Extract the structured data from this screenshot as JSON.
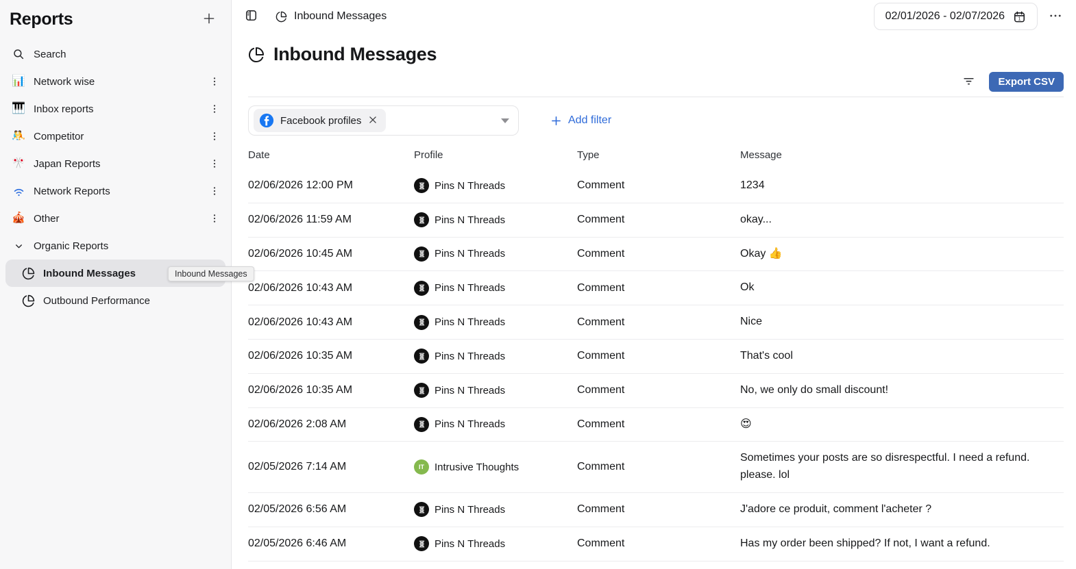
{
  "sidebar": {
    "title": "Reports",
    "tooltip": "Inbound Messages",
    "items": [
      {
        "label": "Search",
        "icon": "search"
      },
      {
        "label": "Network wise",
        "icon": "bar-chart-emoji",
        "glyph": "📊"
      },
      {
        "label": "Inbox reports",
        "icon": "piano-emoji",
        "glyph": "🎹"
      },
      {
        "label": "Competitor",
        "icon": "wrestlers-emoji",
        "glyph": "🤼"
      },
      {
        "label": "Japan Reports",
        "icon": "crossed-flags-emoji",
        "glyph": "🎌"
      },
      {
        "label": "Network Reports",
        "icon": "wifi"
      },
      {
        "label": "Other",
        "icon": "circus-tent-emoji",
        "glyph": "🎪"
      },
      {
        "label": "Organic Reports",
        "icon": "chevron-down"
      },
      {
        "label": "Inbound Messages",
        "icon": "pie-chart",
        "selected": true
      },
      {
        "label": "Outbound Performance",
        "icon": "pie-chart"
      }
    ]
  },
  "topbar": {
    "breadcrumb": "Inbound Messages",
    "date_range": "02/01/2026 - 02/07/2026"
  },
  "page": {
    "title": "Inbound Messages",
    "export_label": "Export CSV"
  },
  "filters": {
    "chip_label": "Facebook profiles",
    "add_filter_label": "Add filter"
  },
  "table": {
    "headers": [
      "Date",
      "Profile",
      "Type",
      "Message"
    ],
    "rows": [
      {
        "date": "02/06/2026 12:00 PM",
        "profile": "Pins N Threads",
        "type": "Comment",
        "message": "1234",
        "avatar": {
          "style": "logo",
          "bg": "#111111"
        }
      },
      {
        "date": "02/06/2026 11:59 AM",
        "profile": "Pins N Threads",
        "type": "Comment",
        "message": "okay...",
        "avatar": {
          "style": "logo",
          "bg": "#111111"
        }
      },
      {
        "date": "02/06/2026 10:45 AM",
        "profile": "Pins N Threads",
        "type": "Comment",
        "message": "Okay 👍",
        "avatar": {
          "style": "logo",
          "bg": "#111111"
        }
      },
      {
        "date": "02/06/2026 10:43 AM",
        "profile": "Pins N Threads",
        "type": "Comment",
        "message": "Ok",
        "avatar": {
          "style": "logo",
          "bg": "#111111"
        }
      },
      {
        "date": "02/06/2026 10:43 AM",
        "profile": "Pins N Threads",
        "type": "Comment",
        "message": "Nice",
        "avatar": {
          "style": "logo",
          "bg": "#111111"
        }
      },
      {
        "date": "02/06/2026 10:35 AM",
        "profile": "Pins N Threads",
        "type": "Comment",
        "message": "That's cool",
        "avatar": {
          "style": "logo",
          "bg": "#111111"
        }
      },
      {
        "date": "02/06/2026 10:35 AM",
        "profile": "Pins N Threads",
        "type": "Comment",
        "message": "No, we only do small discount!",
        "avatar": {
          "style": "logo",
          "bg": "#111111"
        }
      },
      {
        "date": "02/06/2026 2:08 AM",
        "profile": "Pins N Threads",
        "type": "Comment",
        "message": "😍",
        "avatar": {
          "style": "logo",
          "bg": "#111111"
        }
      },
      {
        "date": "02/05/2026 7:14 AM",
        "profile": "Intrusive Thoughts",
        "type": "Comment",
        "message": "Sometimes your posts are so disrespectful. I need a refund. please. lol",
        "avatar": {
          "style": "initials",
          "text": "IT",
          "bg": "#85b94e"
        }
      },
      {
        "date": "02/05/2026 6:56 AM",
        "profile": "Pins N Threads",
        "type": "Comment",
        "message": "J'adore ce produit, comment l'acheter ?",
        "avatar": {
          "style": "logo",
          "bg": "#111111"
        }
      },
      {
        "date": "02/05/2026 6:46 AM",
        "profile": "Pins N Threads",
        "type": "Comment",
        "message": "Has my order been shipped? If not, I want a refund.",
        "avatar": {
          "style": "logo",
          "bg": "#111111"
        }
      }
    ]
  },
  "colors": {
    "export_button": "#3d69b5",
    "add_filter_link": "#2f6bd9",
    "facebook_blue": "#1877f2",
    "selected_item_bg": "#e4e4e7",
    "initials_avatar_green": "#85b94e"
  }
}
